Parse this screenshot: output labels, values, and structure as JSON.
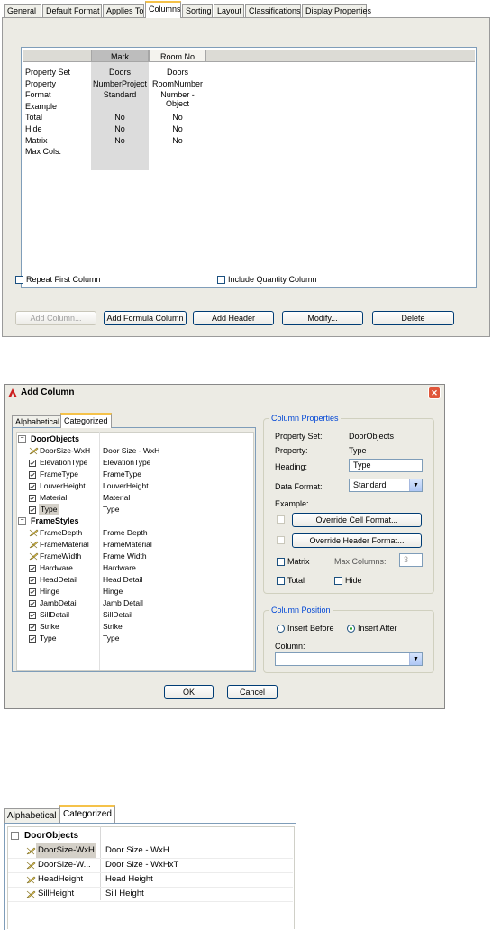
{
  "top_panel": {
    "tabs": [
      "General",
      "Default Format",
      "Applies To",
      "Columns",
      "Sorting",
      "Layout",
      "Classifications",
      "Display Properties"
    ],
    "active_tab": "Columns",
    "columns": [
      {
        "header": "Mark",
        "values": [
          "Doors",
          "NumberProject",
          "Standard",
          "",
          "No",
          "No",
          "No",
          ""
        ]
      },
      {
        "header": "Room No",
        "values": [
          "Doors",
          "RoomNumber",
          "Number - Object",
          "",
          "No",
          "No",
          "No",
          ""
        ]
      }
    ],
    "row_labels": [
      "Property Set",
      "Property",
      "Format",
      "Example",
      "Total",
      "Hide",
      "Matrix",
      "Max Cols."
    ],
    "repeat_first_column": "Repeat First Column",
    "include_quantity_column": "Include Quantity Column",
    "buttons": [
      "Add Column...",
      "Add Formula Column",
      "Add Header",
      "Modify...",
      "Delete"
    ]
  },
  "dialog": {
    "title": "Add Column",
    "close_glyph": "✕",
    "tabs": [
      "Alphabetical",
      "Categorized"
    ],
    "active_tab": "Categorized",
    "groups": [
      {
        "name": "DoorObjects",
        "expander": "−",
        "items": [
          {
            "name": "DoorSize-WxH",
            "value": "Door Size - WxH",
            "icon": "pencil-icon"
          },
          {
            "name": "ElevationType",
            "value": "ElevationType",
            "icon": "checkbox-icon"
          },
          {
            "name": "FrameType",
            "value": "FrameType",
            "icon": "checkbox-icon"
          },
          {
            "name": "LouverHeight",
            "value": "LouverHeight",
            "icon": "checkbox-icon"
          },
          {
            "name": "Material",
            "value": "Material",
            "icon": "checkbox-icon"
          },
          {
            "name": "Type",
            "value": "Type",
            "icon": "checkbox-icon"
          }
        ]
      },
      {
        "name": "FrameStyles",
        "expander": "−",
        "items": [
          {
            "name": "FrameDepth",
            "value": "Frame Depth",
            "icon": "pencil-icon"
          },
          {
            "name": "FrameMaterial",
            "value": "FrameMaterial",
            "icon": "pencil-icon"
          },
          {
            "name": "FrameWidth",
            "value": "Frame Width",
            "icon": "pencil-icon"
          },
          {
            "name": "Hardware",
            "value": "Hardware",
            "icon": "checkbox-icon"
          },
          {
            "name": "HeadDetail",
            "value": "Head Detail",
            "icon": "checkbox-icon"
          },
          {
            "name": "Hinge",
            "value": "Hinge",
            "icon": "checkbox-icon"
          },
          {
            "name": "JambDetail",
            "value": "Jamb Detail",
            "icon": "checkbox-icon"
          },
          {
            "name": "SillDetail",
            "value": "SillDetail",
            "icon": "checkbox-icon"
          },
          {
            "name": "Strike",
            "value": "Strike",
            "icon": "checkbox-icon"
          },
          {
            "name": "Type",
            "value": "Type",
            "icon": "checkbox-icon"
          }
        ]
      }
    ],
    "column_properties": {
      "title": "Column Properties",
      "property_set_label": "Property Set:",
      "property_set_value": "DoorObjects",
      "property_label": "Property:",
      "property_value": "Type",
      "heading_label": "Heading:",
      "heading_value": "Type",
      "data_format_label": "Data Format:",
      "data_format_value": "Standard",
      "example_label": "Example:",
      "override_cell": "Override Cell Format...",
      "override_header": "Override Header Format...",
      "matrix_label": "Matrix",
      "max_columns_label": "Max Columns:",
      "max_columns_value": "3",
      "total_label": "Total",
      "hide_label": "Hide"
    },
    "column_position": {
      "title": "Column Position",
      "insert_before": "Insert Before",
      "insert_after": "Insert After",
      "selected": "Insert After",
      "column_label": "Column:",
      "column_value": ""
    },
    "ok": "OK",
    "cancel": "Cancel"
  },
  "bottom_panel": {
    "tabs": [
      "Alphabetical",
      "Categorized"
    ],
    "active_tab": "Categorized",
    "group": "DoorObjects",
    "expander": "−",
    "items": [
      {
        "name": "DoorSize-WxH",
        "value": "Door Size - WxH"
      },
      {
        "name": "DoorSize-W...",
        "value": "Door Size - WxHxT"
      },
      {
        "name": "HeadHeight",
        "value": "Head Height"
      },
      {
        "name": "SillHeight",
        "value": "Sill Height"
      }
    ]
  }
}
